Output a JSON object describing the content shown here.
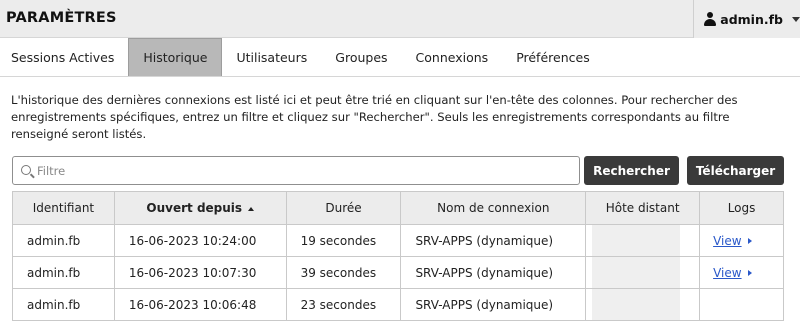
{
  "header": {
    "title": "PARAMÈTRES",
    "user": "admin.fb"
  },
  "tabs": [
    {
      "label": "Sessions Actives",
      "active": false
    },
    {
      "label": "Historique",
      "active": true
    },
    {
      "label": "Utilisateurs",
      "active": false
    },
    {
      "label": "Groupes",
      "active": false
    },
    {
      "label": "Connexions",
      "active": false
    },
    {
      "label": "Préférences",
      "active": false
    }
  ],
  "description": "L'historique des dernières connexions est listé ici et peut être trié en cliquant sur l'en-tête des colonnes. Pour rechercher des enregistrements spécifiques, entrez un filtre et cliquez sur \"Rechercher\". Seuls les enregistrements correspondants au filtre renseigné seront listés.",
  "search": {
    "placeholder": "Filtre",
    "value": "",
    "search_label": "Rechercher",
    "download_label": "Télécharger"
  },
  "table": {
    "columns": [
      "Identifiant",
      "Ouvert depuis",
      "Durée",
      "Nom de connexion",
      "Hôte distant",
      "Logs"
    ],
    "sorted_column": "Ouvert depuis",
    "rows": [
      {
        "user": "admin.fb",
        "opened": "16-06-2023 10:24:00",
        "duration": "19 secondes",
        "connection": "SRV-APPS (dynamique)",
        "host": "",
        "logs": "View"
      },
      {
        "user": "admin.fb",
        "opened": "16-06-2023 10:07:30",
        "duration": "39 secondes",
        "connection": "SRV-APPS (dynamique)",
        "host": "",
        "logs": "View"
      },
      {
        "user": "admin.fb",
        "opened": "16-06-2023 10:06:48",
        "duration": "23 secondes",
        "connection": "SRV-APPS (dynamique)",
        "host": "",
        "logs": ""
      }
    ]
  },
  "colors": {
    "header_bg": "#ececec",
    "active_tab_bg": "#b8b8b8",
    "button_bg": "#3a3a3a",
    "link": "#2a58c9"
  }
}
